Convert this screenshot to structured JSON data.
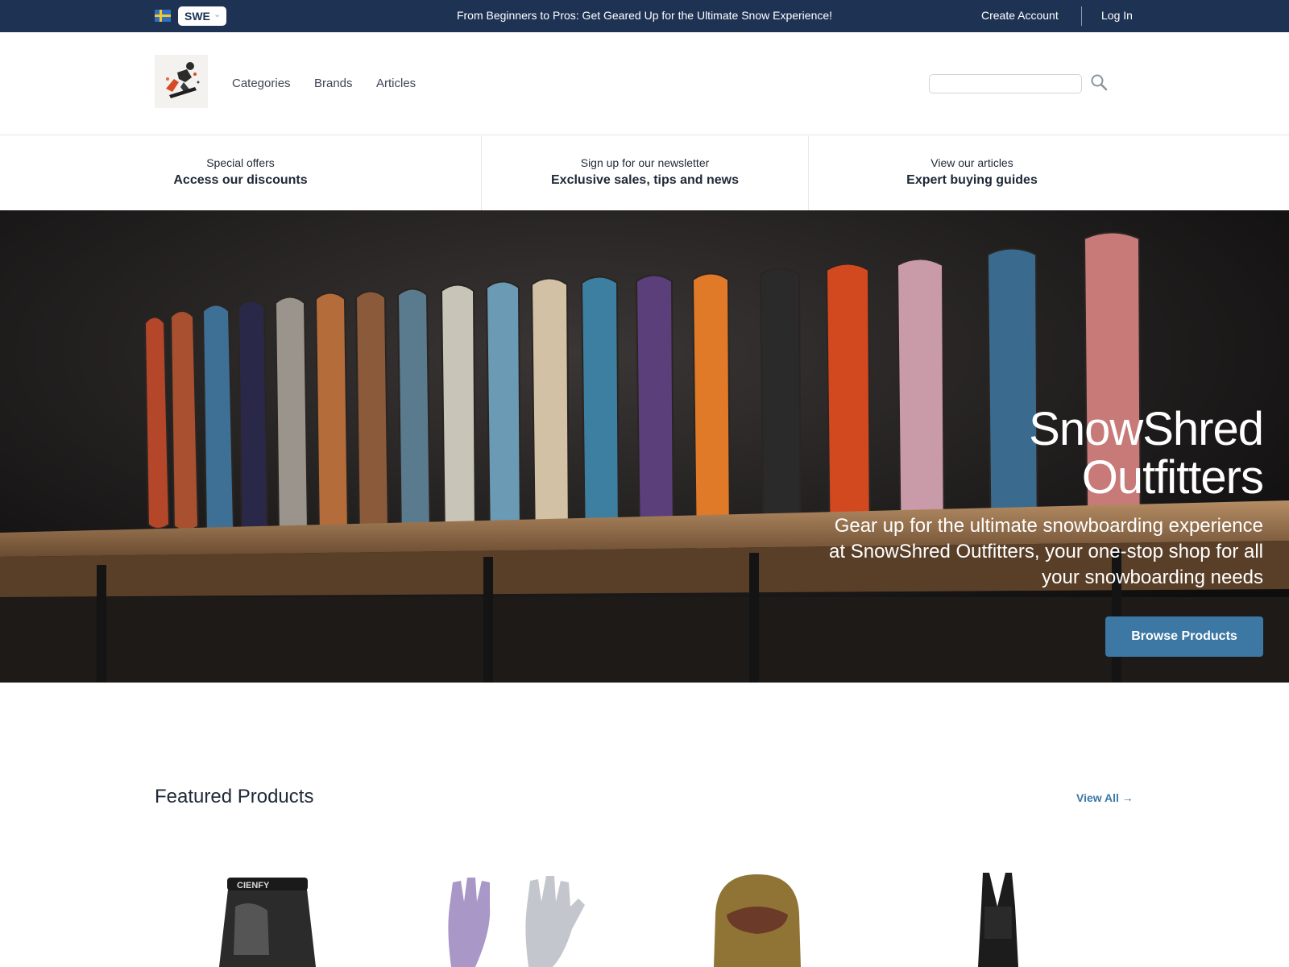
{
  "topbar": {
    "country_code": "SWE",
    "announcement": "From Beginners to Pros: Get Geared Up for the Ultimate Snow Experience!",
    "create_account": "Create Account",
    "login": "Log In",
    "background": "#1e3354"
  },
  "header": {
    "nav": [
      "Categories",
      "Brands",
      "Articles"
    ],
    "search_placeholder": ""
  },
  "promos": [
    {
      "small": "Special offers",
      "big": "Access our discounts"
    },
    {
      "small": "Sign up for our newsletter",
      "big": "Exclusive sales, tips and news"
    },
    {
      "small": "View our articles",
      "big": "Expert buying guides"
    }
  ],
  "hero": {
    "title_line1": "SnowShred",
    "title_line2": "Outfitters",
    "subtitle": "Gear up for the ultimate snowboarding experience at SnowShred Outfitters, your one-stop shop for all your snowboarding needs",
    "cta": "Browse Products",
    "accent": "#3d78a4"
  },
  "featured": {
    "title": "Featured Products",
    "view_all": "View All →",
    "products": [
      "protective shorts",
      "gloves",
      "balaclava",
      "bib pants"
    ]
  }
}
